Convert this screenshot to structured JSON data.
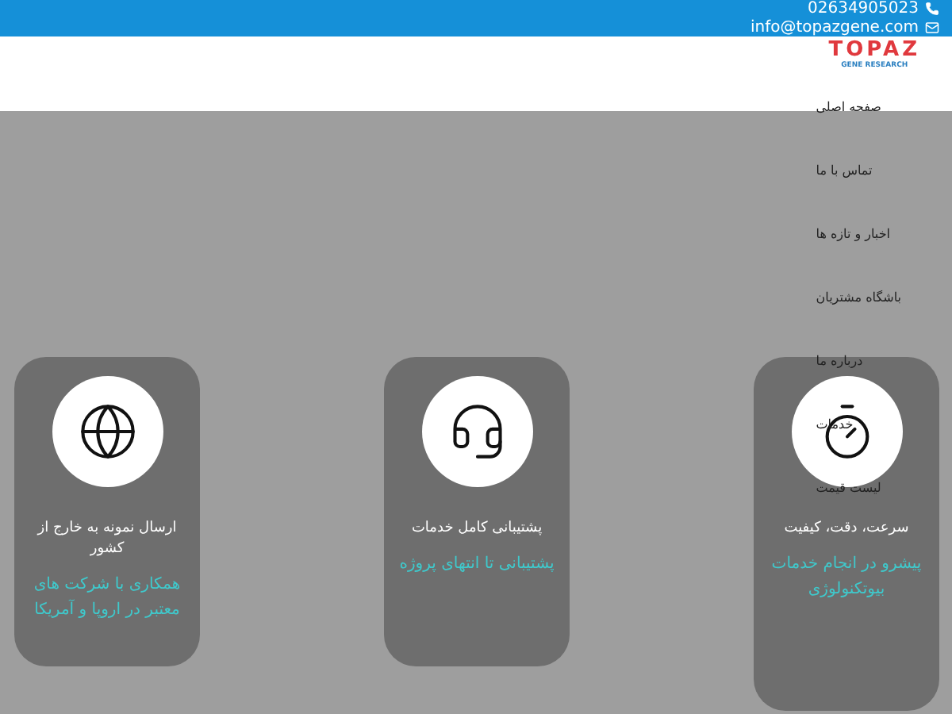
{
  "top_bar": {
    "phone": "02634905023",
    "email": "info@topazgene.com"
  },
  "logo": {
    "name": "TOPAZ",
    "tagline": "GENE RESEARCH"
  },
  "nav": {
    "items": [
      {
        "label": "صفحه اصلی"
      },
      {
        "label": "تماس با ما"
      },
      {
        "label": "اخبار و تازه ها"
      },
      {
        "label": "باشگاه مشتریان"
      },
      {
        "label": "درباره ما"
      },
      {
        "label": "خدمات"
      },
      {
        "label": "لیست قیمت"
      }
    ]
  },
  "cards": [
    {
      "kind": "stopwatch",
      "title": "سرعت، دقت، کیفیت",
      "subtitle": "پیشرو در انجام خدمات بیوتکنولوژی"
    },
    {
      "kind": "support",
      "title": "پشتیبانی کامل خدمات",
      "subtitle": "پشتیبانی تا انتهای پروژه"
    },
    {
      "kind": "globe",
      "title": "ارسال نمونه به خارج از کشور",
      "subtitle": "همکاری با شرکت های معتبر در اروپا و آمریکا"
    }
  ]
}
